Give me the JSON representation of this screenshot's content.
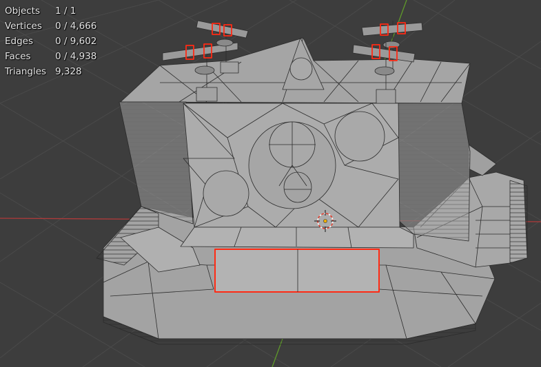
{
  "viewport": {
    "background": "#3d3d3d",
    "grid_color": "#4a4a4a",
    "x_axis_color": "#b03a3a",
    "y_axis_color": "#5f9a2a",
    "mesh_fill": "#a9a9a9",
    "mesh_edge": "#2b2b2b",
    "selection_color": "#ff2a14"
  },
  "statistics": [
    {
      "label": "Objects",
      "value": "1 / 1"
    },
    {
      "label": "Vertices",
      "value": "0 / 4,666"
    },
    {
      "label": "Edges",
      "value": "0 / 9,602"
    },
    {
      "label": "Faces",
      "value": "0 / 4,938"
    },
    {
      "label": "Triangles",
      "value": "9,328"
    }
  ]
}
